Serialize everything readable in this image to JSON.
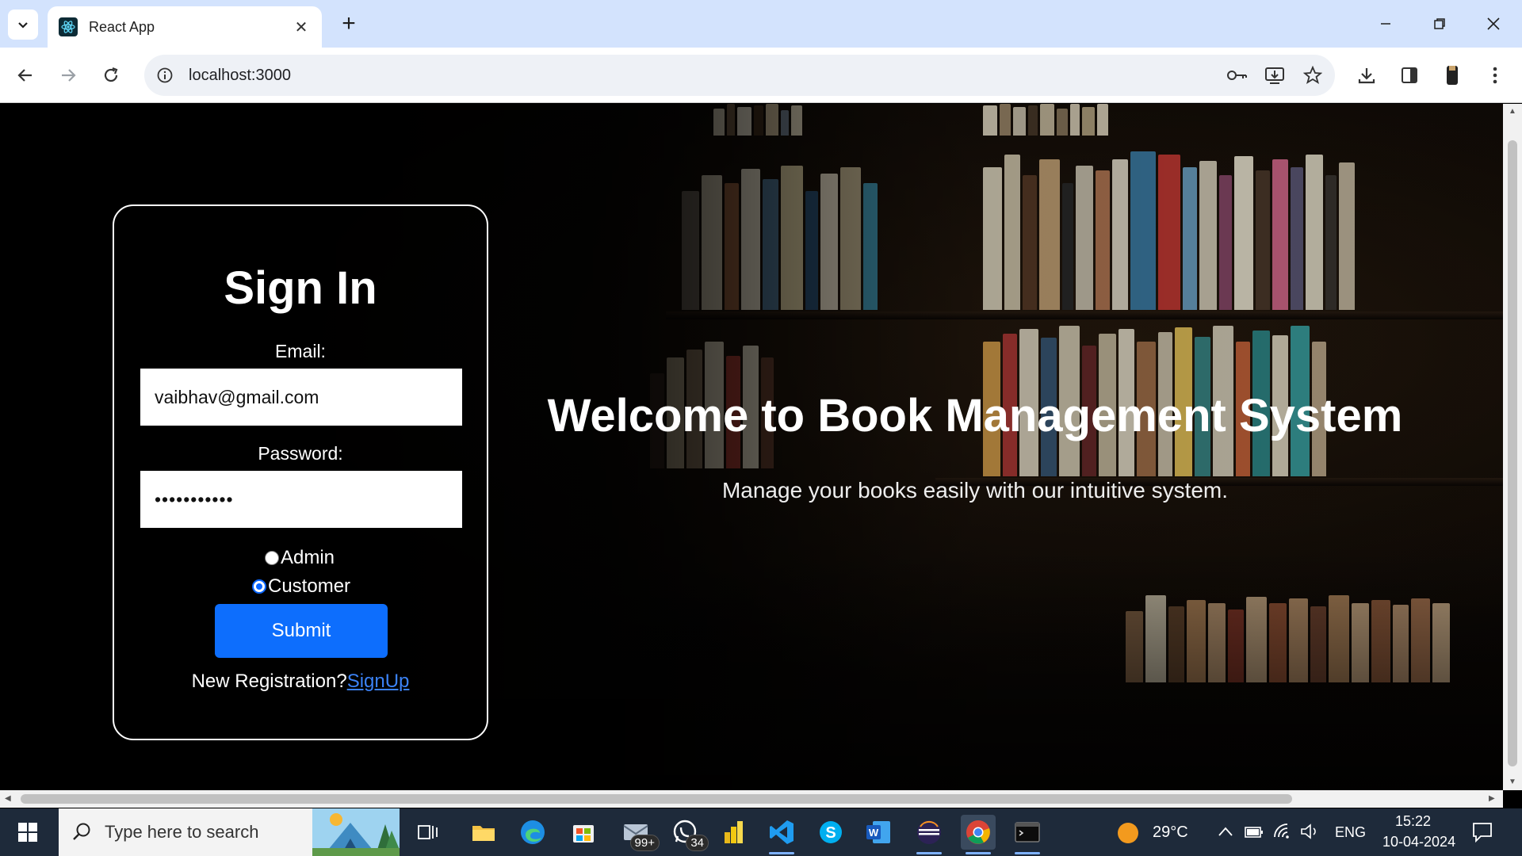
{
  "browser": {
    "tab_title": "React App",
    "close_glyph": "✕",
    "new_tab_glyph": "+",
    "url": "localhost:3000"
  },
  "page": {
    "login": {
      "title": "Sign In",
      "email_label": "Email:",
      "email_value": "vaibhav@gmail.com",
      "password_label": "Password:",
      "password_value": "•••••••••••",
      "roles": [
        {
          "label": "Admin",
          "checked": false
        },
        {
          "label": "Customer",
          "checked": true
        }
      ],
      "submit_label": "Submit",
      "registration_text": "New Registration?",
      "signup_link": "SignUp"
    },
    "hero": {
      "title": "Welcome to Book Management System",
      "subtitle": "Manage your books easily with our intuitive system."
    }
  },
  "taskbar": {
    "search_placeholder": "Type here to search",
    "mail_badge": "99+",
    "whatsapp_badge": "34",
    "weather": "29°C",
    "language": "ENG",
    "time": "15:22",
    "date": "10-04-2024"
  },
  "colors": {
    "accent": "#0d6efd",
    "tabbar": "#d3e3fd",
    "link": "#3b82f6"
  }
}
